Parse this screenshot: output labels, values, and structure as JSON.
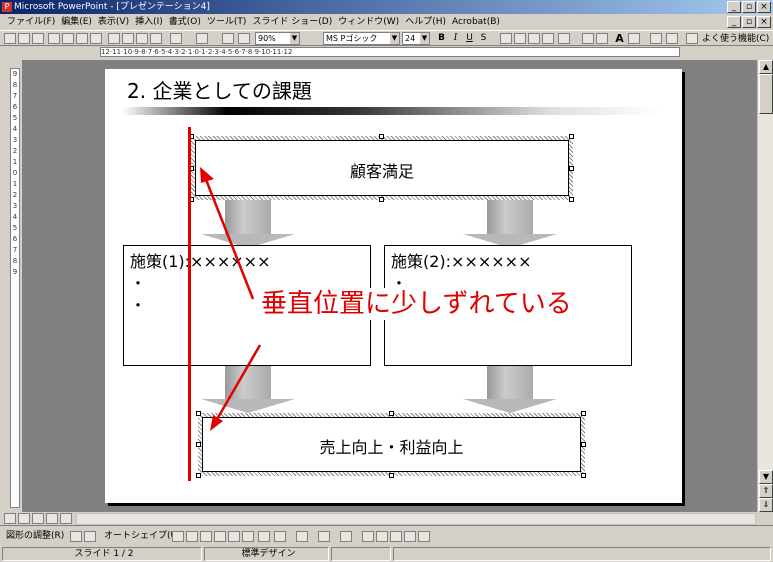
{
  "window": {
    "title": "Microsoft PowerPoint - [プレゼンテーション4]",
    "app_icon": "P"
  },
  "menu": {
    "items": [
      "ファイル(F)",
      "編集(E)",
      "表示(V)",
      "挿入(I)",
      "書式(O)",
      "ツール(T)",
      "スライド ショー(D)",
      "ウィンドウ(W)",
      "ヘルプ(H)",
      "Acrobat(B)"
    ]
  },
  "toolbar": {
    "zoom": "90%",
    "font_name": "MS Pゴシック",
    "font_size": "24",
    "bold": "B",
    "italic": "I",
    "underline": "U",
    "shadow": "S",
    "grow_font": "A",
    "frequent_functions": "よく使う機能(C)"
  },
  "ruler": {
    "horizontal": "12·11·10·9·8·7·6·5·4·3·2·1·0·1·2·3·4·5·6·7·8·9·10·11·12",
    "vertical": [
      "9",
      "8",
      "7",
      "6",
      "5",
      "4",
      "3",
      "2",
      "1",
      "0",
      "1",
      "2",
      "3",
      "4",
      "5",
      "6",
      "7",
      "8",
      "9"
    ]
  },
  "slide": {
    "title": "2. 企業としての課題",
    "top_box": "顧客満足",
    "measure1": {
      "heading": "施策(1):××××××",
      "bullets": [
        "・",
        "・"
      ]
    },
    "measure2": {
      "heading": "施策(2):××××××",
      "bullets": [
        "・"
      ]
    },
    "bottom_box": "売上向上・利益向上",
    "annotation": "垂直位置に少しずれている",
    "annotation_color": "#e00000"
  },
  "drawing_toolbar": {
    "draw_menu": "図形の調整(R)",
    "autoshape_menu": "オートシェイプ(U)"
  },
  "status": {
    "slide": "スライド 1 / 2",
    "design": "標準デザイン"
  }
}
